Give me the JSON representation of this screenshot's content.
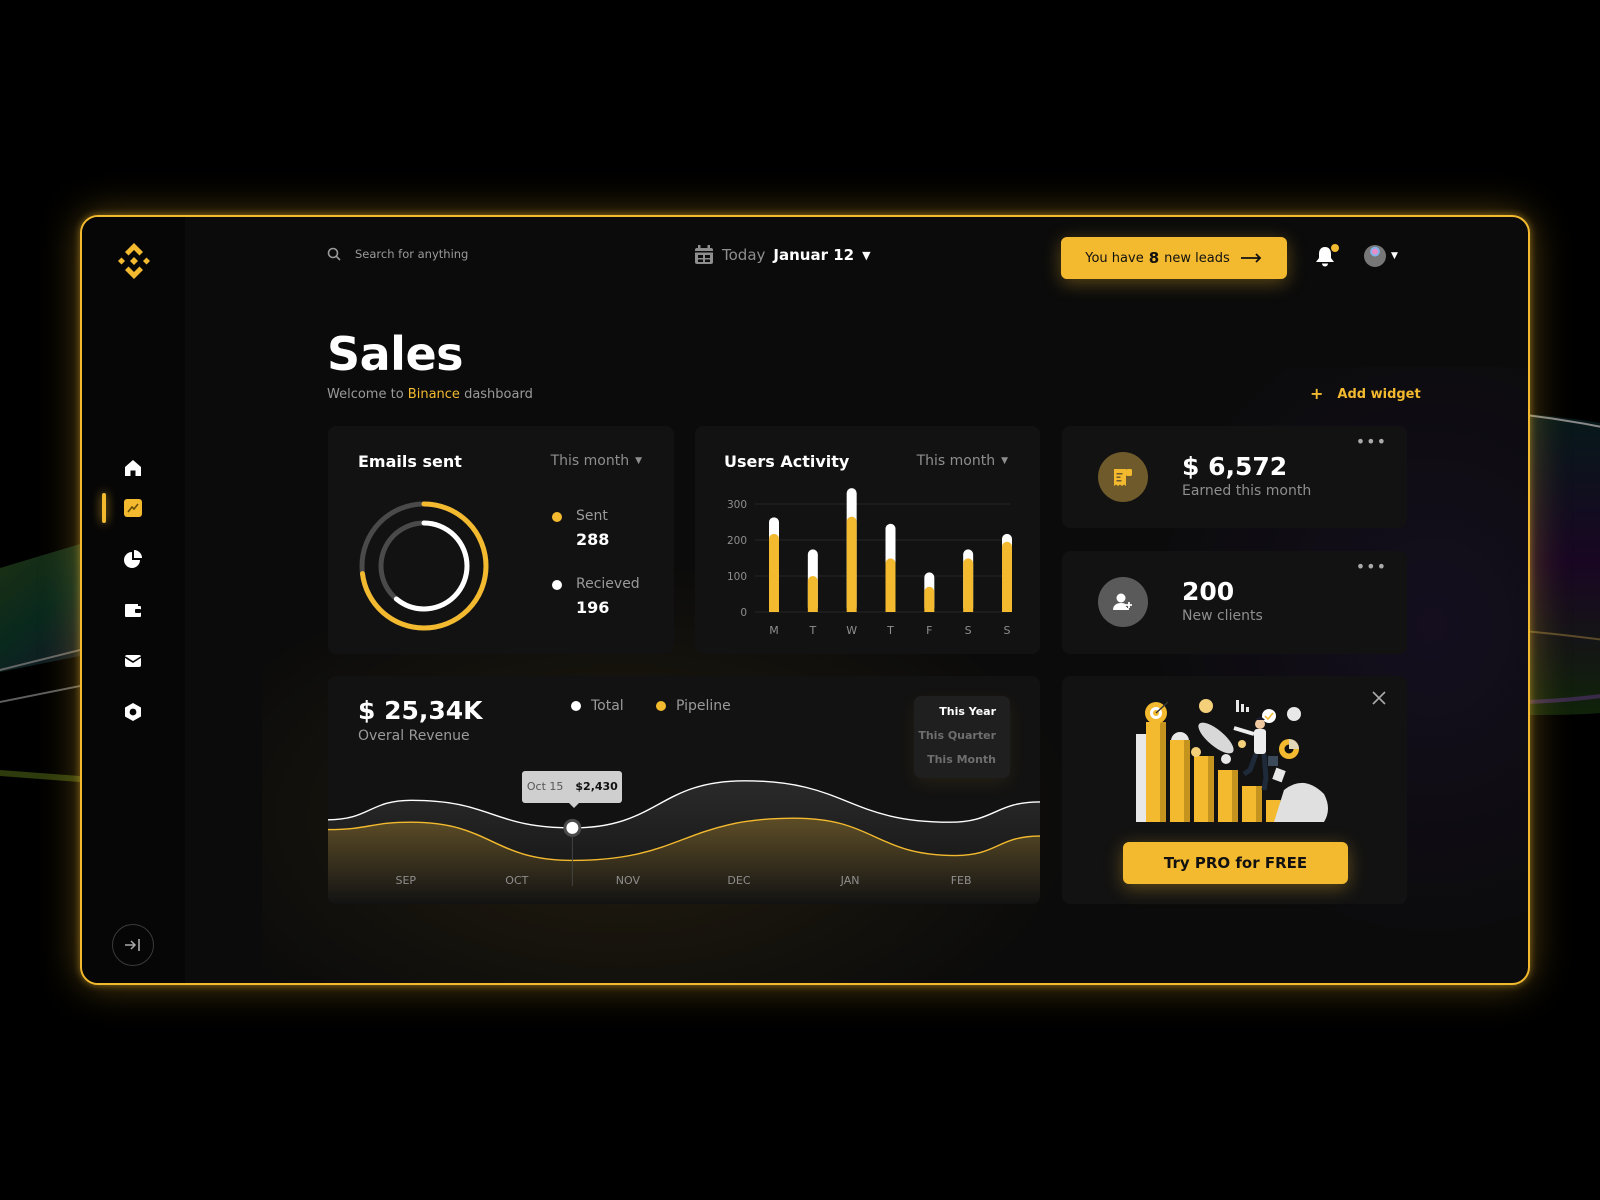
{
  "header": {
    "search_placeholder": "Search for anything",
    "date_prefix": "Today",
    "date_value": "Januar 12",
    "leads_prefix": "You have",
    "leads_count": "8",
    "leads_suffix": "new leads",
    "has_notification": true
  },
  "sidebar": {
    "items": [
      {
        "name": "home",
        "icon": "home-icon",
        "active": false
      },
      {
        "name": "sales",
        "icon": "trend-chart-icon",
        "active": true
      },
      {
        "name": "reports",
        "icon": "pie-chart-icon",
        "active": false
      },
      {
        "name": "wallet",
        "icon": "wallet-icon",
        "active": false
      },
      {
        "name": "messages",
        "icon": "mail-icon",
        "active": false
      },
      {
        "name": "settings",
        "icon": "hexagon-settings-icon",
        "active": false
      }
    ],
    "collapse_icon": "arrow-collapse-right-icon"
  },
  "page": {
    "title": "Sales",
    "subtitle_prefix": "Welcome to",
    "subtitle_brand": "Binance",
    "subtitle_suffix": "dashboard",
    "add_widget_label": "Add widget",
    "add_widget_icon": "+"
  },
  "colors": {
    "accent": "#F3BA2F",
    "card": "#121212",
    "track": "#4a4a4a",
    "secondary": "#ffffff"
  },
  "emails": {
    "title": "Emails sent",
    "filter": "This month",
    "sent_label": "Sent",
    "sent_value": "288",
    "received_label": "Recieved",
    "received_value": "196",
    "sent_ratio": 0.73,
    "received_ratio": 0.61
  },
  "earned": {
    "value": "$ 6,572",
    "label": "Earned this month",
    "icon": "receipt-icon"
  },
  "clients": {
    "value": "200",
    "label": "New clients",
    "icon": "add-user-icon"
  },
  "revenue": {
    "value": "$ 25,34K",
    "label": "Overal Revenue",
    "legend_total": "Total",
    "legend_pipeline": "Pipeline",
    "periods": [
      "This Year",
      "This Quarter",
      "This Month"
    ],
    "active_period": 0,
    "tooltip_date": "Oct 15",
    "tooltip_value": "$2,430"
  },
  "promo": {
    "button_label": "Try PRO for FREE",
    "close_icon": "close-icon",
    "illustration": "growth-chart-illustration"
  },
  "chart_data": [
    {
      "type": "bar",
      "title": "Users Activity",
      "filter": "This month",
      "categories": [
        "M",
        "T",
        "W",
        "T",
        "F",
        "S",
        "S"
      ],
      "series": [
        {
          "name": "primary",
          "color": "#F3BA2F",
          "values": [
            217,
            100,
            265,
            149,
            70,
            149,
            195
          ]
        },
        {
          "name": "total",
          "color": "#ffffff",
          "values": [
            263,
            174,
            344,
            245,
            110,
            174,
            217
          ]
        }
      ],
      "yticks": [
        0,
        100,
        200,
        300
      ],
      "ylim": [
        0,
        300
      ],
      "grid": true
    },
    {
      "type": "area",
      "title": "Overal Revenue",
      "xlabels": [
        "SEP",
        "OCT",
        "NOV",
        "DEC",
        "JAN",
        "FEB"
      ],
      "xlim": [
        -0.7,
        5.71
      ],
      "ylim": [
        1000,
        4200
      ],
      "series": [
        {
          "name": "Total",
          "color": "#ffffff",
          "points": [
            [
              -0.7,
              2630
            ],
            [
              0.05,
              3110
            ],
            [
              1.5,
              2430
            ],
            [
              3.05,
              3590
            ],
            [
              4.9,
              2570
            ],
            [
              5.71,
              3070
            ]
          ]
        },
        {
          "name": "Pipeline",
          "color": "#F3BA2F",
          "points": [
            [
              -0.7,
              2390
            ],
            [
              0.05,
              2570
            ],
            [
              1.5,
              1630
            ],
            [
              3.5,
              2670
            ],
            [
              4.95,
              1750
            ],
            [
              5.71,
              2230
            ]
          ]
        }
      ],
      "highlight": {
        "x": 1.5,
        "label": "Oct 15",
        "value": 2430
      },
      "legend": "top-center"
    }
  ]
}
